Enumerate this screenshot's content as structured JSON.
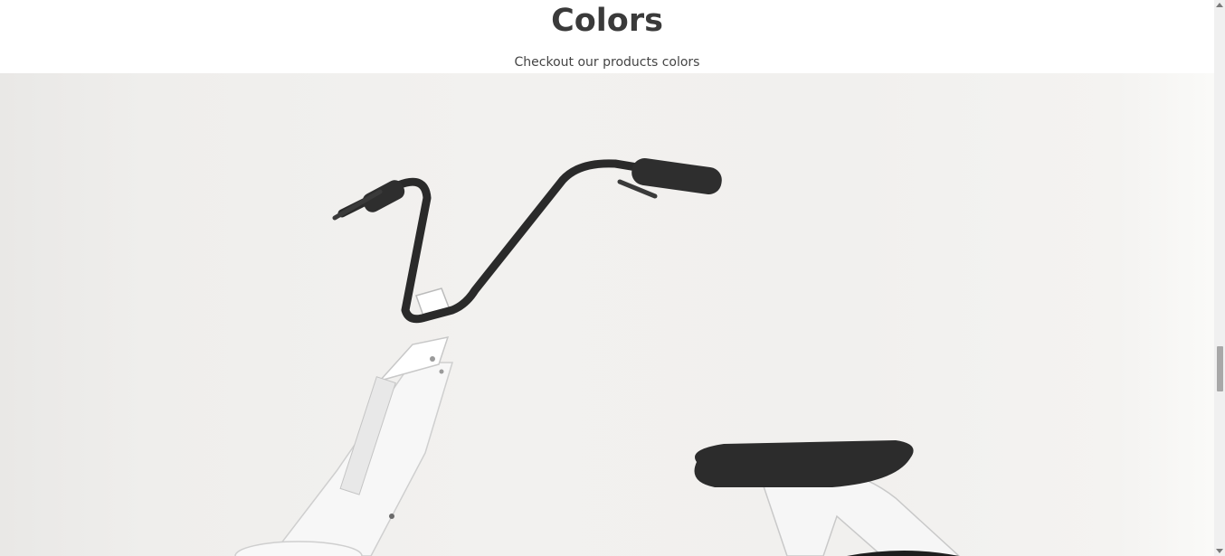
{
  "section": {
    "title": "Colors",
    "subtitle": "Checkout our products colors"
  },
  "hero_image": {
    "icon": "electric-bike-product-photo"
  },
  "colors": {
    "accent": "#5f8a7e",
    "title_text": "#3a3a3a",
    "background": "#ffffff"
  }
}
